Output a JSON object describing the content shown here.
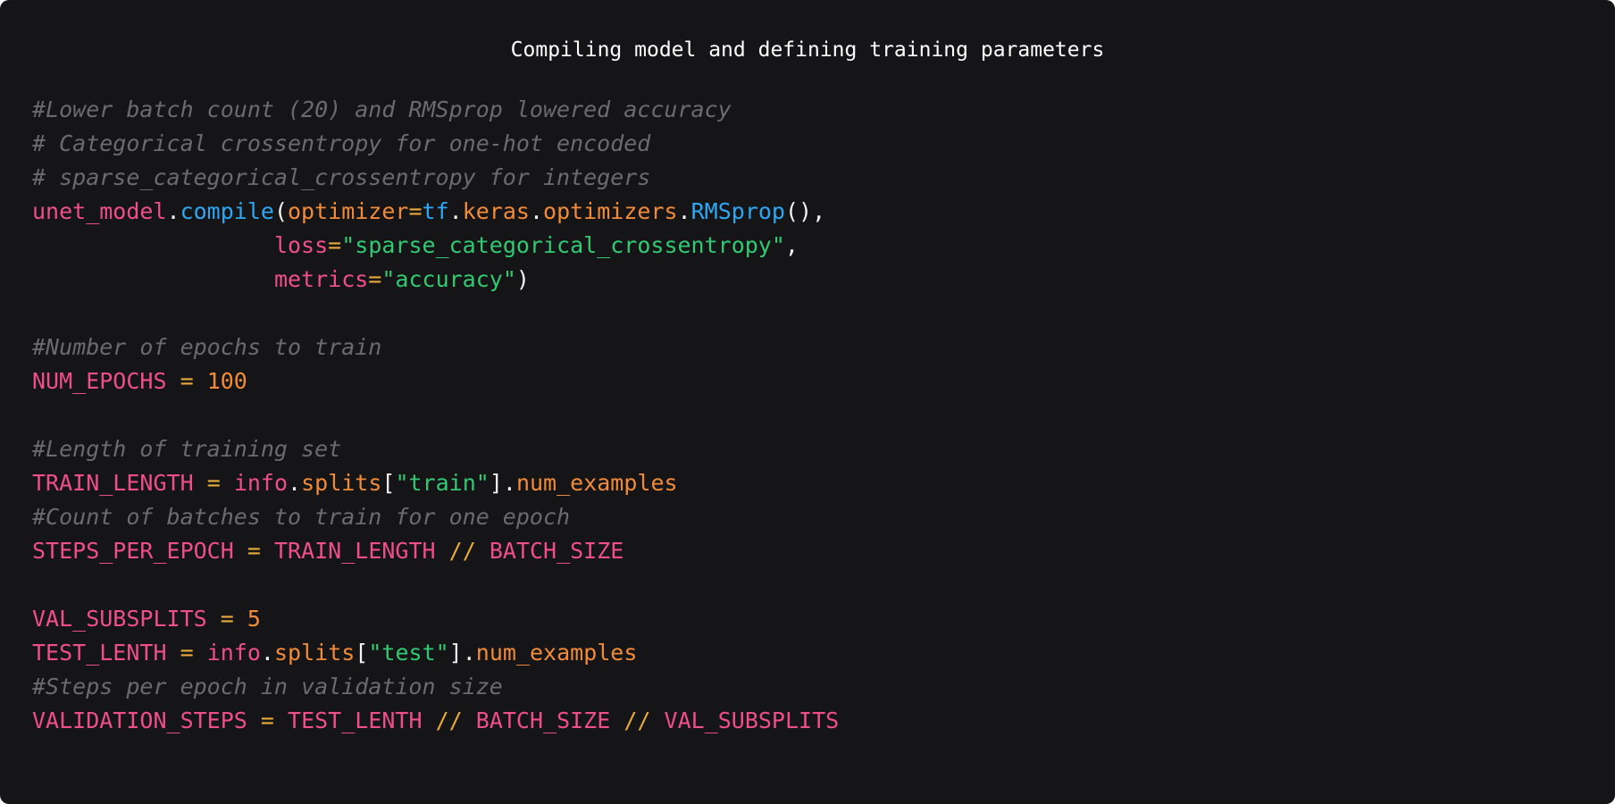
{
  "header": {
    "title": "Compiling model and defining training parameters"
  },
  "code": {
    "comment_batch": "#Lower batch count (20) and RMSprop lowered accuracy",
    "comment_categorical": "# Categorical crossentropy for one-hot encoded",
    "comment_sparse": "# sparse_categorical_crossentropy for integers",
    "compile": {
      "object": "unet_model",
      "method": "compile",
      "optimizer_kw": "optimizer",
      "module_tf": "tf",
      "module_keras": "keras",
      "module_optimizers": "optimizers",
      "optimizer_fn": "RMSprop",
      "loss_kw": "loss",
      "loss_value": "\"sparse_categorical_crossentropy\"",
      "metrics_kw": "metrics",
      "metrics_value": "\"accuracy\""
    },
    "comment_epochs": "#Number of epochs to train",
    "num_epochs_var": "NUM_EPOCHS",
    "num_epochs_value": "100",
    "comment_length": "#Length of training set",
    "train_length_var": "TRAIN_LENGTH",
    "info_var": "info",
    "splits_attr": "splits",
    "train_key": "\"train\"",
    "num_examples_attr": "num_examples",
    "comment_count": "#Count of batches to train for one epoch",
    "steps_per_epoch_var": "STEPS_PER_EPOCH",
    "floor_div": "//",
    "batch_size_var": "BATCH_SIZE",
    "val_subsplits_var": "VAL_SUBSPLITS",
    "val_subsplits_value": "5",
    "test_length_var": "TEST_LENTH",
    "test_key": "\"test\"",
    "comment_steps": "#Steps per epoch in validation size",
    "validation_steps_var": "VALIDATION_STEPS"
  },
  "colors": {
    "background": "#151517",
    "comment": "#6b6b6b",
    "variable": "#ef4f86",
    "function": "#2ea7f2",
    "attribute": "#f28b39",
    "operator": "#e8a93a",
    "string": "#32c973",
    "plain": "#f2f2f2"
  }
}
